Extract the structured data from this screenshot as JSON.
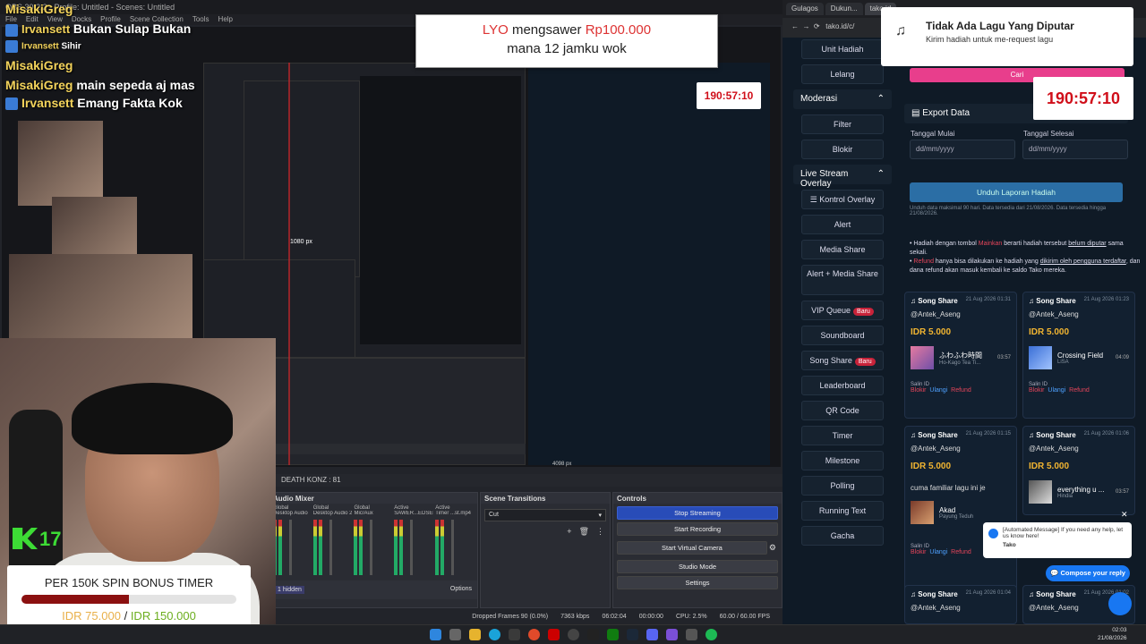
{
  "obs": {
    "title": "OBS 30.2.2 - Profile: Untitled - Scenes: Untitled",
    "menu": [
      "File",
      "Edit",
      "View",
      "Docks",
      "Profile",
      "Scene Collection",
      "Tools",
      "Help"
    ],
    "death_counter": "DEATH KONZ : 81",
    "audio_mixer_title": "Audio Mixer",
    "scene_transitions_title": "Scene Transitions",
    "controls_title": "Controls",
    "transition_value": "Cut",
    "controls": [
      "Stop Streaming",
      "Start Recording",
      "Start Virtual Camera",
      "Studio Mode",
      "Settings"
    ],
    "mixer_channels": [
      {
        "name": "Desktop Audio",
        "tag": "Global"
      },
      {
        "name": "Desktop Audio 2",
        "tag": "Global"
      },
      {
        "name": "Mic/Aux",
        "tag": "Global"
      },
      {
        "name": "SAWER...EDSER",
        "tag": "Active"
      },
      {
        "name": "Timer ...st.mp4",
        "tag": "Active"
      }
    ],
    "hidden_label": "1 hidden",
    "options_label": "Options",
    "status_bar": {
      "dropped": "Dropped Frames 90 (0.0%)",
      "kbps": "7363 kbps",
      "live_time": "06:02:04",
      "rec_time": "00:00:00",
      "cpu": "CPU: 2.5%",
      "fps": "60.00 / 60.00 FPS"
    },
    "nested_res_label": "1080 px",
    "duration_label": "4098 px"
  },
  "overlay": {
    "chat": [
      {
        "name": "MisakiGreg",
        "msg": ""
      },
      {
        "name": "Irvansett",
        "msg": "Bukan Sulap Bukan"
      },
      {
        "name": "Irvansett",
        "msg": "Sihir"
      },
      {
        "name": "MisakiGreg",
        "msg": ""
      },
      {
        "name": "MisakiGreg",
        "msg": "main sepeda aj mas"
      },
      {
        "name": "Irvansett",
        "msg": "Emang Fakta Kok"
      }
    ],
    "donation": {
      "name": "LYO",
      "verb": "mengsawer",
      "amount": "Rp100.000",
      "message": "mana 12 jamku wok"
    },
    "spin": {
      "title": "PER 150K SPIN BONUS TIMER",
      "current": "IDR 75.000",
      "separator": "/",
      "target": "IDR 150.000",
      "progress": 0.5
    },
    "kick_count": "17",
    "timer": "190:57:10",
    "nowplaying": {
      "title": "Tidak Ada Lagu Yang Diputar",
      "subtitle": "Kirim hadiah untuk me-request lagu",
      "icon": "music-note-icon"
    }
  },
  "browser": {
    "tabs": [
      "Gulagos",
      "Dukun...",
      "tako.id"
    ],
    "url": "tako.id/c/",
    "sidebar": {
      "top_items": [
        "Unit Hadiah",
        "Lelang"
      ],
      "moderasi": "Moderasi",
      "moderasi_items": [
        "Filter",
        "Blokir"
      ],
      "live_overlay": "Live Stream Overlay",
      "overlay_items": [
        {
          "label": "Kontrol Overlay",
          "badge": ""
        },
        {
          "label": "Alert",
          "badge": ""
        },
        {
          "label": "Media Share",
          "badge": ""
        },
        {
          "label": "Alert + Media Share",
          "badge": ""
        },
        {
          "label": "VIP Queue",
          "badge": "Baru"
        },
        {
          "label": "Soundboard",
          "badge": ""
        },
        {
          "label": "Song Share",
          "badge": "Baru"
        },
        {
          "label": "Leaderboard",
          "badge": ""
        },
        {
          "label": "QR Code",
          "badge": ""
        },
        {
          "label": "Timer",
          "badge": ""
        },
        {
          "label": "Milestone",
          "badge": ""
        },
        {
          "label": "Polling",
          "badge": ""
        },
        {
          "label": "Running Text",
          "badge": ""
        },
        {
          "label": "Gacha",
          "badge": ""
        }
      ]
    },
    "cari_label": "Cari",
    "export": {
      "title": "Export Data",
      "start_label": "Tanggal Mulai",
      "end_label": "Tanggal Selesai",
      "placeholder": "dd/mm/yyyy",
      "button": "Unduh Laporan Hadiah",
      "note": "Unduh data maksimal 90 hari. Data tersedia dari 21/08/2026. Data tersedia hingga 21/08/2026."
    },
    "info": {
      "line1_a": "Hadiah dengan tombol ",
      "line1_b": "Mainkan",
      "line1_c": " berarti hadiah tersebut ",
      "line1_d": "belum diputar",
      "line1_e": " sama sekali.",
      "line2_a": "Refund",
      "line2_b": " hanya bisa dilakukan ke hadiah yang ",
      "line2_c": "dikirim oleh pengguna terdaftar",
      "line2_d": ", dan dana refund akan masuk kembali ke saldo Tako mereka."
    },
    "cards": [
      {
        "type": "Song Share",
        "date": "21 Aug 2026 01:31",
        "user": "@Antek_Aseng",
        "amount": "IDR 5.000",
        "note": "",
        "song": "ふわふわ時間",
        "artist": "Ho-Kago Tea Ti...",
        "dur": "03:57",
        "actions": [
          "Blokir",
          "Ulangi",
          "Refund"
        ],
        "salin": "Salin ID"
      },
      {
        "type": "Song Share",
        "date": "21 Aug 2026 01:23",
        "user": "@Antek_Aseng",
        "amount": "IDR 5.000",
        "note": "",
        "song": "Crossing Field",
        "artist": "LiSA",
        "dur": "04:09",
        "actions": [
          "Blokir",
          "Ulangi",
          "Refund"
        ],
        "salin": "Salin ID"
      },
      {
        "type": "Song Share",
        "date": "21 Aug 2026 01:15",
        "user": "@Antek_Aseng",
        "amount": "IDR 5.000",
        "note": "cuma familiar lagu ini je",
        "song": "Akad",
        "artist": "Payung Teduh",
        "dur": "",
        "actions": [
          "Blokir",
          "Ulangi",
          "Refund"
        ],
        "salin": "Salin ID"
      },
      {
        "type": "Song Share",
        "date": "21 Aug 2026 01:06",
        "user": "@Antek_Aseng",
        "amount": "IDR 5.000",
        "note": "",
        "song": "everything u ...",
        "artist": "Hindia",
        "dur": "03:57",
        "actions": [
          "Blokir",
          "Ulangi",
          "Refund"
        ],
        "salin": "Salin ID"
      },
      {
        "type": "Song Share",
        "date": "21 Aug 2026 01:04",
        "user": "@Antek_Aseng",
        "amount": "",
        "note": "",
        "song": "",
        "artist": "",
        "dur": "",
        "actions": [],
        "salin": ""
      },
      {
        "type": "Song Share",
        "date": "21 Aug 2026 01:02",
        "user": "@Antek_Aseng",
        "amount": "",
        "note": "",
        "song": "",
        "artist": "",
        "dur": "",
        "actions": [],
        "salin": ""
      }
    ],
    "chat_popup": {
      "message": "[Automated Message] If you need any help, let us know here!",
      "sender": "Tako"
    },
    "compose_label": "Compose your reply"
  },
  "taskbar": {
    "time": "02:03",
    "date": "21/08/2026"
  }
}
